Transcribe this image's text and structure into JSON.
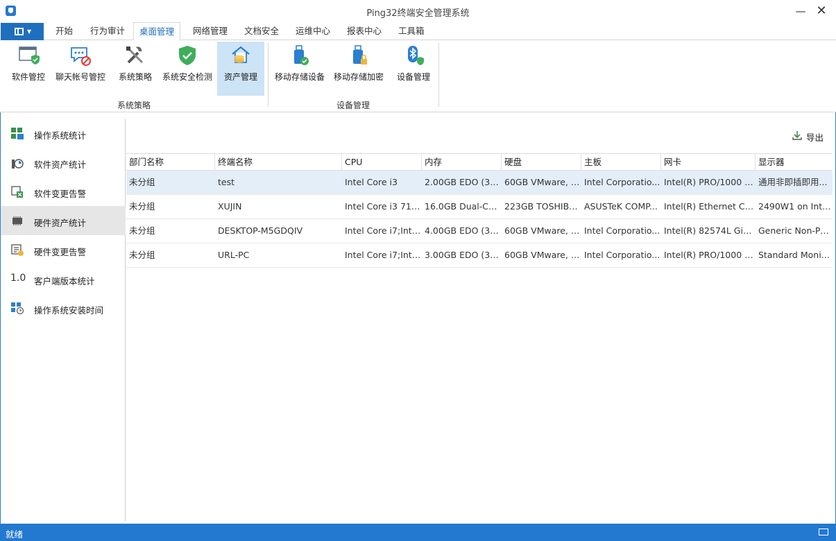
{
  "window": {
    "title": "Ping32终端安全管理系统",
    "min": "—",
    "close": "✕"
  },
  "menu": {
    "tabs": [
      "开始",
      "行为审计",
      "桌面管理",
      "网络管理",
      "文档安全",
      "运维中心",
      "报表中心",
      "工具箱"
    ],
    "active": "桌面管理"
  },
  "ribbon": {
    "buttons": [
      {
        "label": "软件管控",
        "icon": "software-control-icon"
      },
      {
        "label": "聊天帐号管控",
        "icon": "chat-account-block-icon"
      },
      {
        "label": "系统策略",
        "icon": "tools-icon"
      },
      {
        "label": "系统安全检测",
        "icon": "shield-check-icon"
      },
      {
        "label": "资产管理",
        "icon": "asset-house-coins-icon"
      },
      {
        "label": "移动存储设备",
        "icon": "usb-check-icon"
      },
      {
        "label": "移动存储加密",
        "icon": "usb-lock-icon"
      },
      {
        "label": "设备管理",
        "icon": "bluetooth-device-icon"
      }
    ],
    "groups": [
      "系统策略",
      "设备管理"
    ]
  },
  "sidebar": {
    "items": [
      {
        "label": "操作系统统计",
        "icon": "os-stats-icon"
      },
      {
        "label": "软件资产统计",
        "icon": "software-asset-icon"
      },
      {
        "label": "软件变更告警",
        "icon": "software-change-alert-icon"
      },
      {
        "label": "硬件资产统计",
        "icon": "hardware-chip-icon"
      },
      {
        "label": "硬件变更告警",
        "icon": "hardware-change-alert-icon"
      },
      {
        "label": "客户端版本统计",
        "icon": "version-icon",
        "glyph": "1.0"
      },
      {
        "label": "操作系统安装时间",
        "icon": "os-install-time-icon"
      }
    ],
    "selected": "硬件资产统计"
  },
  "toolbar": {
    "export_label": "导出"
  },
  "table": {
    "columns": [
      "部门名称",
      "终端名称",
      "CPU",
      "内存",
      "硬盘",
      "主板",
      "网卡",
      "显示器"
    ],
    "rows": [
      [
        "未分组",
        "test",
        "Intel Core i3",
        "2.00GB EDO (3-3-...",
        "60GB VMware, V...",
        "Intel Corporatio...",
        "Intel(R) PRO/1000 M...",
        "通用非即插即用..."
      ],
      [
        "未分组",
        "XUJIN",
        "Intel Core i3 7100",
        "16.0GB Dual-Cha...",
        "223GB TOSHIBA...",
        "ASUSTeK COMP...",
        "Intel(R) Ethernet Con...",
        "2490W1 on Intel..."
      ],
      [
        "未分组",
        "DESKTOP-M5GDQIV",
        "Intel Core i7;Intel...",
        "4.00GB EDO (3-3-...",
        "60GB VMware, V...",
        "Intel Corporatio...",
        "Intel(R) 82574L Giga...",
        "Generic Non-Pn..."
      ],
      [
        "未分组",
        "URL-PC",
        "Intel Core i7;Intel...",
        "3.00GB EDO (3-3-...",
        "60GB VMware, V...",
        "Intel Corporatio...",
        "Intel(R) PRO/1000 M...",
        "Standard Monit..."
      ]
    ],
    "selected_row": 0
  },
  "status": {
    "text": "就绪"
  },
  "colors": {
    "accent": "#2379cf",
    "selection": "#cde3f6",
    "row_selection": "#e4eef9"
  }
}
